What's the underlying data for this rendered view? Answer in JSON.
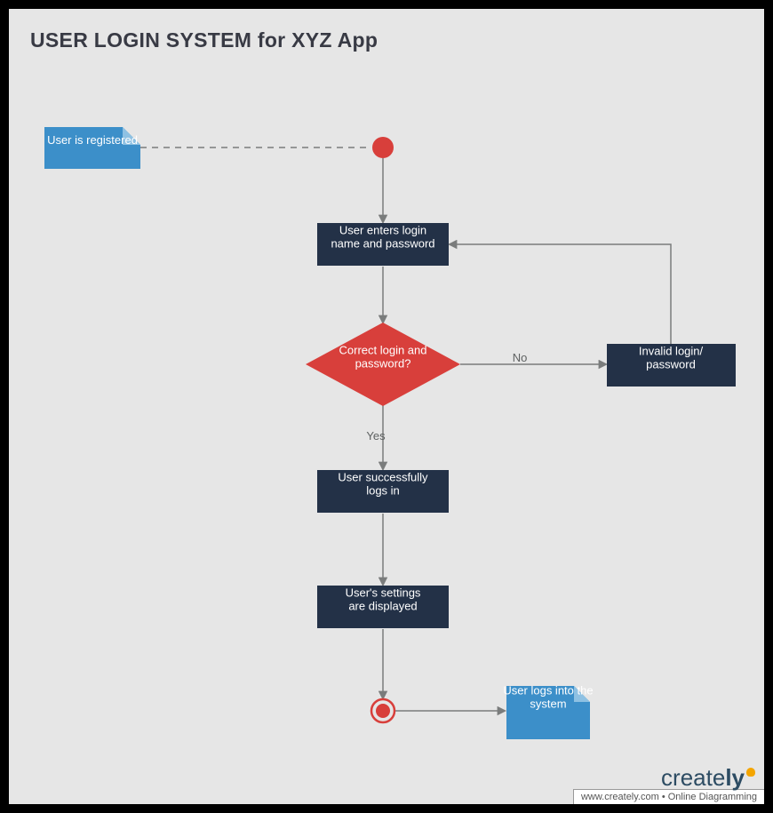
{
  "title": "USER LOGIN SYSTEM for XYZ App",
  "nodes": {
    "note_start": "User is registered",
    "enter_creds": "User enters login name and password",
    "decision": "Correct login and password?",
    "invalid": "Invalid login/ password",
    "success": "User successfully logs in",
    "settings": "User's settings are displayed",
    "note_end": "User logs into the system"
  },
  "edges": {
    "no": "No",
    "yes": "Yes"
  },
  "colors": {
    "process": "#233147",
    "decision": "#D83F3B",
    "note": "#3C8FC9",
    "canvas": "#E6E6E6",
    "connector": "#7A7C7C"
  },
  "footer": {
    "brand_pre": "create",
    "brand_post": "ly",
    "tagline": "www.creately.com • Online Diagramming"
  }
}
